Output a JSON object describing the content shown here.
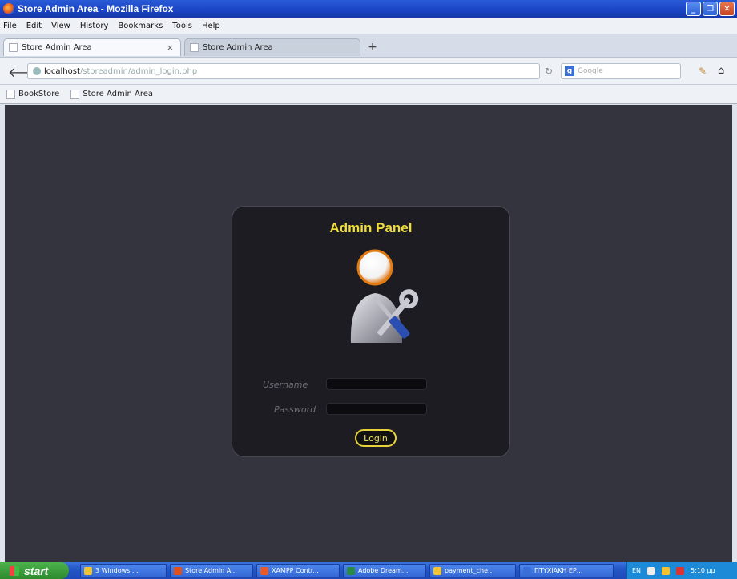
{
  "window": {
    "title": "Store Admin Area - Mozilla Firefox"
  },
  "menu": [
    "File",
    "Edit",
    "View",
    "History",
    "Bookmarks",
    "Tools",
    "Help"
  ],
  "tabs": [
    {
      "label": "Store Admin Area",
      "active": true,
      "close": "×"
    },
    {
      "label": "Store Admin Area",
      "active": false
    }
  ],
  "newtab": "+",
  "nav": {
    "url_host": "localhost",
    "url_path": "/storeadmin/admin_login.php",
    "search_placeholder": "Google"
  },
  "bookmarks": [
    "BookStore",
    "Store Admin Area"
  ],
  "login": {
    "title": "Admin Panel",
    "username_label": "Username",
    "password_label": "Password",
    "login_button": "Login"
  },
  "taskbar": {
    "start": "start",
    "tasks": [
      {
        "label": "3 Windows ...",
        "color": "#f1c232"
      },
      {
        "label": "Store Admin A...",
        "color": "#e0501a"
      },
      {
        "label": "XAMPP Contr...",
        "color": "#e85a2a"
      },
      {
        "label": "Adobe Dream...",
        "color": "#2a8a4a"
      },
      {
        "label": "payment_che...",
        "color": "#f1c232"
      },
      {
        "label": "ΠΤΥΧΙΑΚΗ ΕΡ...",
        "color": "#3a6fd8"
      }
    ],
    "tray_lang": "EN",
    "tray_time": "5:10 μμ"
  },
  "colors": {
    "panel_title": "#f0dc3a",
    "page_bg": "#34343e",
    "panel_bg": "#1c1c22"
  }
}
